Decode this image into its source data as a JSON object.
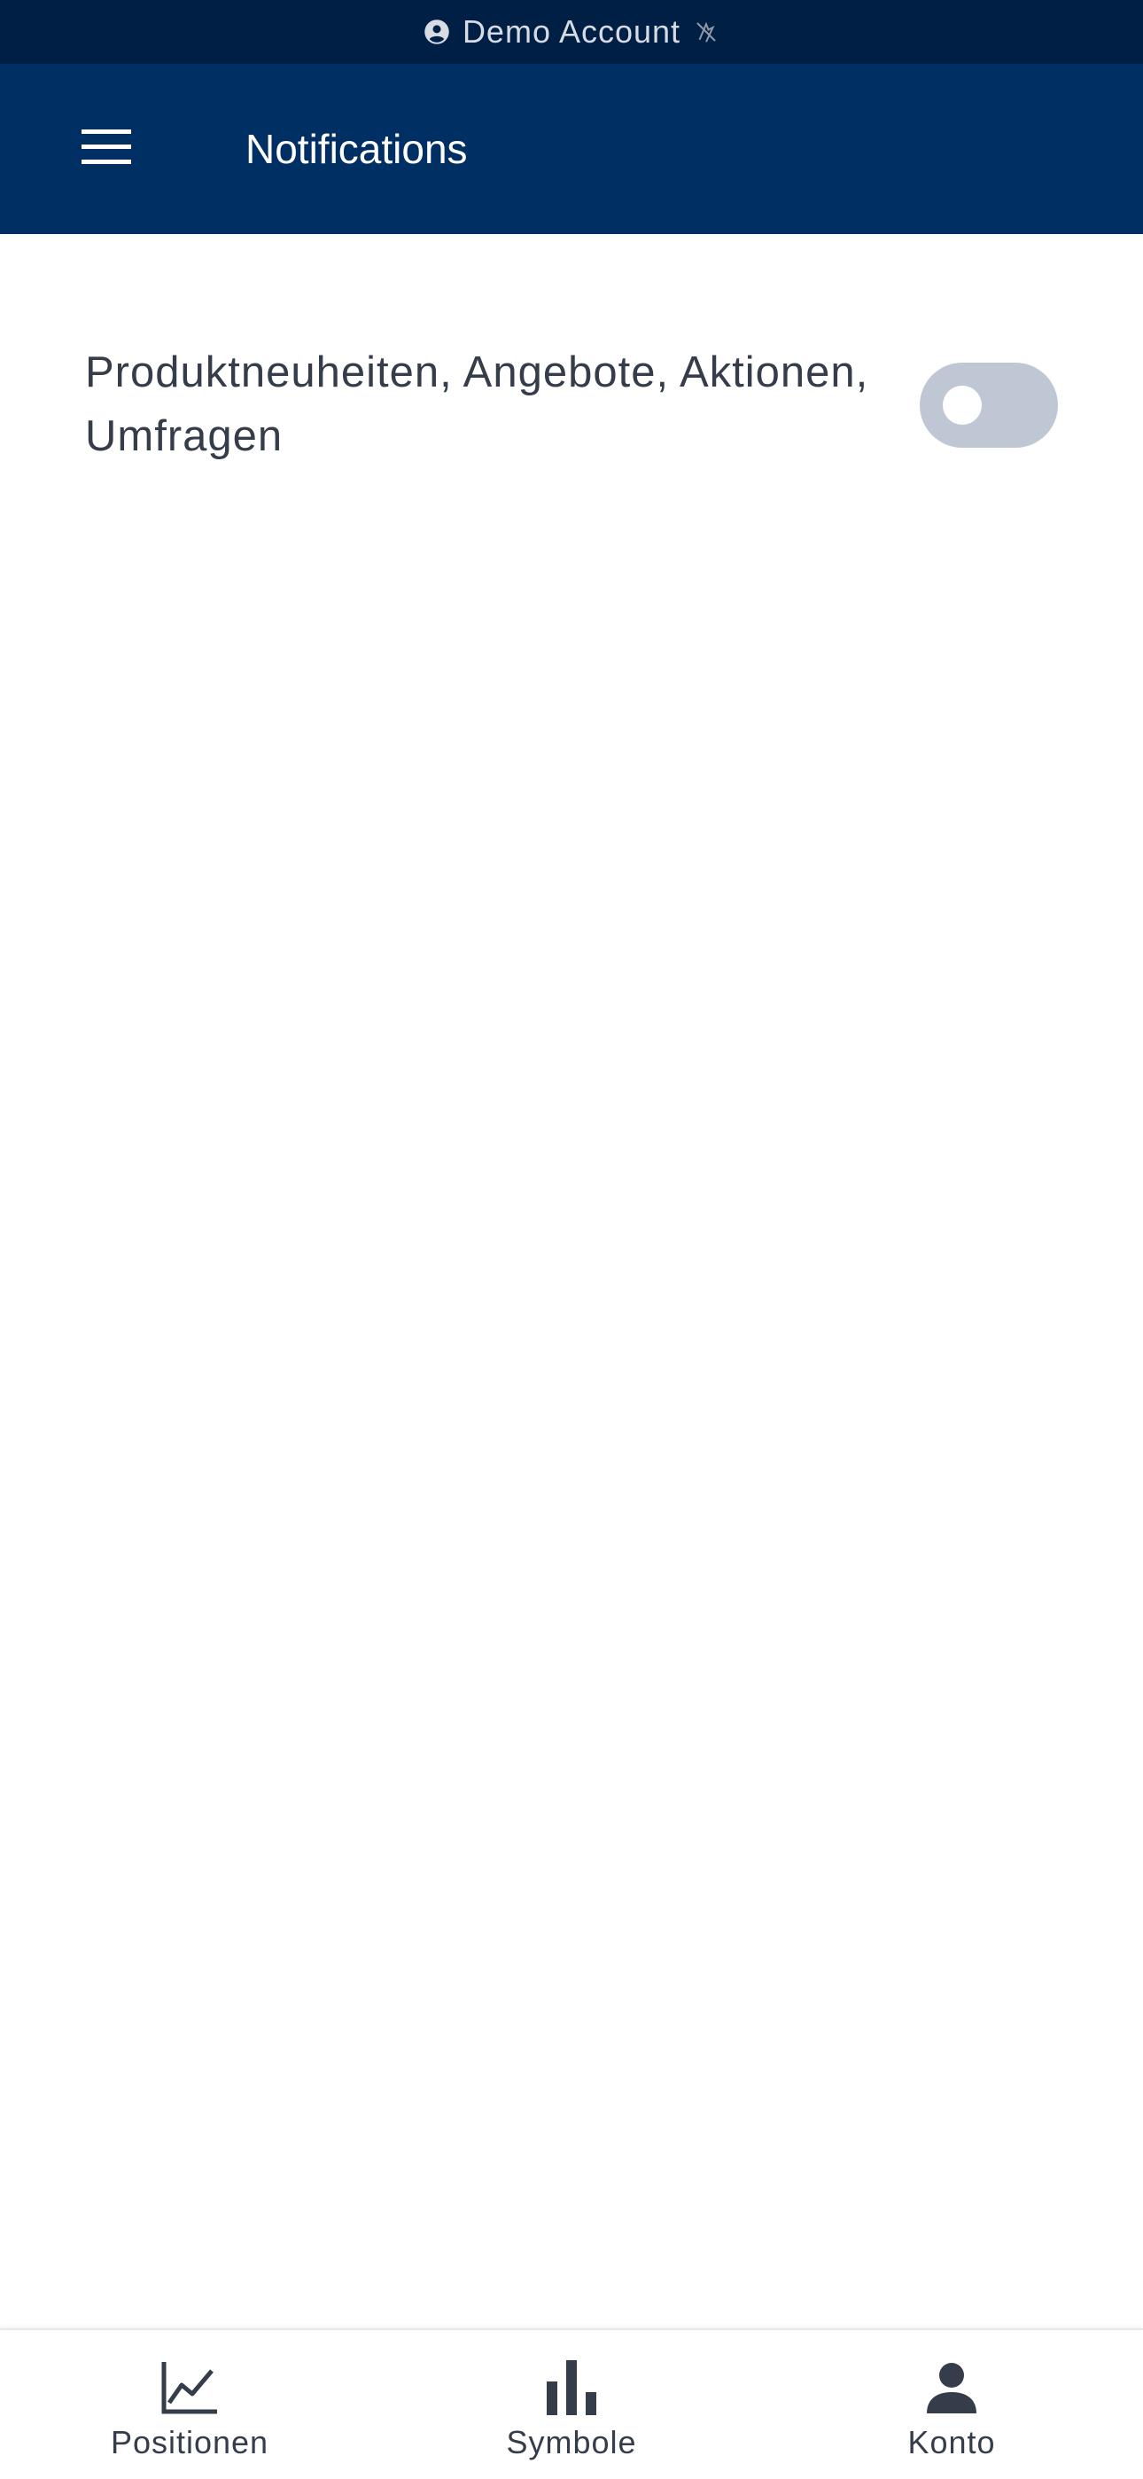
{
  "account_strip": {
    "label": "Demo Account",
    "icons": [
      "account-circle-icon",
      "signal-off-icon"
    ]
  },
  "header": {
    "title": "Notifications",
    "menu_icon": "hamburger-menu-icon"
  },
  "settings": [
    {
      "label": "Produktneuheiten, Angebote, Aktionen, Umfragen",
      "enabled": false
    }
  ],
  "bottom_nav": {
    "items": [
      {
        "label": "Positionen",
        "icon": "line-chart-icon"
      },
      {
        "label": "Symbole",
        "icon": "bar-chart-icon"
      },
      {
        "label": "Konto",
        "icon": "person-icon"
      }
    ]
  },
  "colors": {
    "strip_bg": "#001f44",
    "header_bg": "#002f63",
    "toggle_off": "#c0c7d4",
    "text": "#353c4a"
  }
}
